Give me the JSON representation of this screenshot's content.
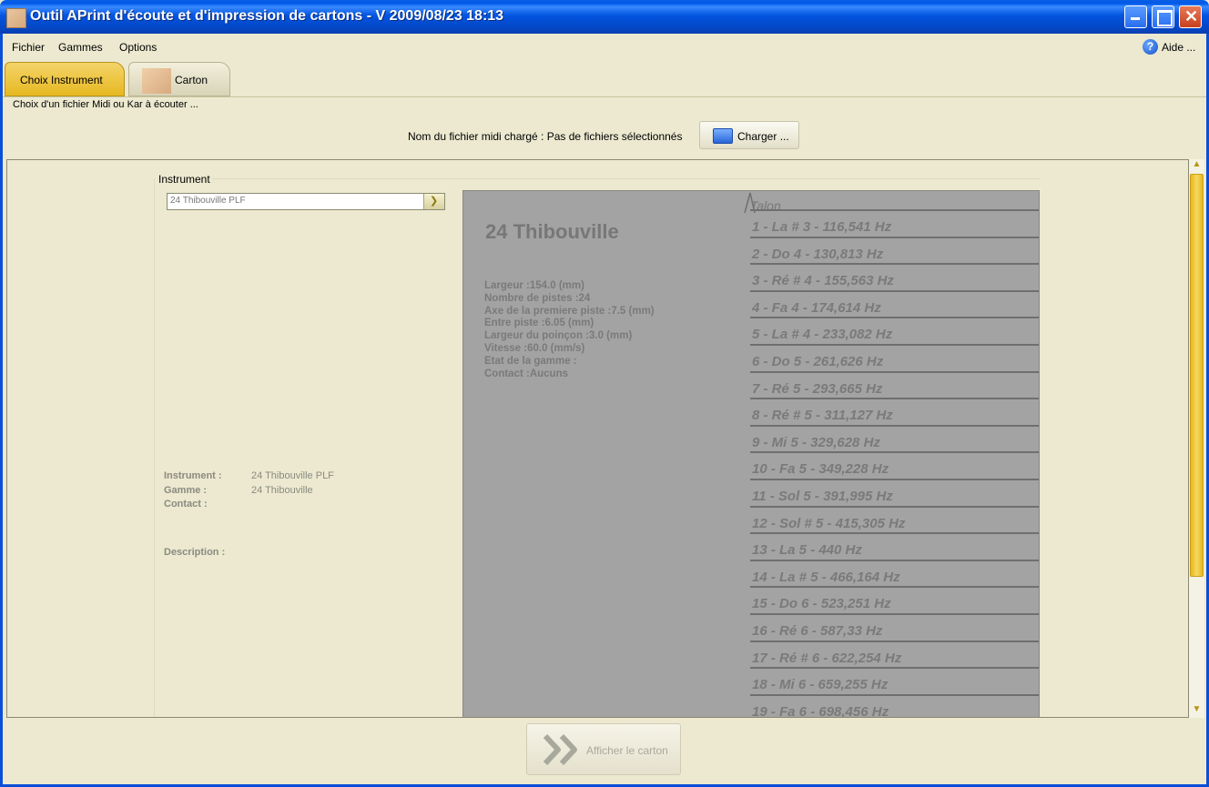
{
  "window": {
    "title": "Outil APrint d'écoute et d'impression de cartons - V 2009/08/23 18:13"
  },
  "menu": {
    "items": [
      "Fichier",
      "Gammes",
      "Options"
    ],
    "help_label": "Aide ..."
  },
  "tabs": [
    {
      "label": "Choix Instrument",
      "active": true
    },
    {
      "label": "Carton",
      "active": false
    }
  ],
  "subtitle": "Choix d'un fichier Midi ou Kar à écouter ...",
  "file": {
    "label": "Nom du fichier midi chargé :",
    "value": "Pas de fichiers sélectionnés",
    "load_button": "Charger ..."
  },
  "instrument": {
    "group_label": "Instrument",
    "selected": "24 Thibouville PLF",
    "info": {
      "instrument_key": "Instrument :",
      "instrument_value": "24 Thibouville PLF",
      "gamme_key": "Gamme :",
      "gamme_value": "24 Thibouville",
      "contact_key": "Contact :",
      "description_key": "Description :"
    }
  },
  "preview": {
    "gamme_name": "24 Thibouville",
    "talon": "Talon",
    "specs": [
      "Largeur :154.0 (mm)",
      "Nombre de pistes :24",
      "Axe de la premiere piste :7.5 (mm)",
      "Entre piste :6.05 (mm)",
      "Largeur du poinçon :3.0 (mm)",
      "Vitesse :60.0 (mm/s)",
      "Etat de la gamme :",
      "Contact :Aucuns"
    ],
    "notes": [
      "1 - La # 3 - 116,541 Hz",
      "2 - Do 4 - 130,813 Hz",
      "3 - Ré # 4 - 155,563 Hz",
      "4 - Fa 4 - 174,614 Hz",
      "5 - La # 4 - 233,082 Hz",
      "6 - Do 5 - 261,626 Hz",
      "7 - Ré 5 - 293,665 Hz",
      "8 - Ré # 5 - 311,127 Hz",
      "9 - Mi 5 - 329,628 Hz",
      "10 - Fa 5 - 349,228 Hz",
      "11 - Sol 5 - 391,995 Hz",
      "12 - Sol # 5 - 415,305 Hz",
      "13 - La 5 - 440 Hz",
      "14 - La # 5 - 466,164 Hz",
      "15 - Do 6 - 523,251 Hz",
      "16 - Ré 6 - 587,33 Hz",
      "17 - Ré # 6 - 622,254 Hz",
      "18 - Mi 6 - 659,255 Hz",
      "19 - Fa 6 - 698,456 Hz"
    ]
  },
  "actions": {
    "show_carton": "Afficher le carton"
  }
}
